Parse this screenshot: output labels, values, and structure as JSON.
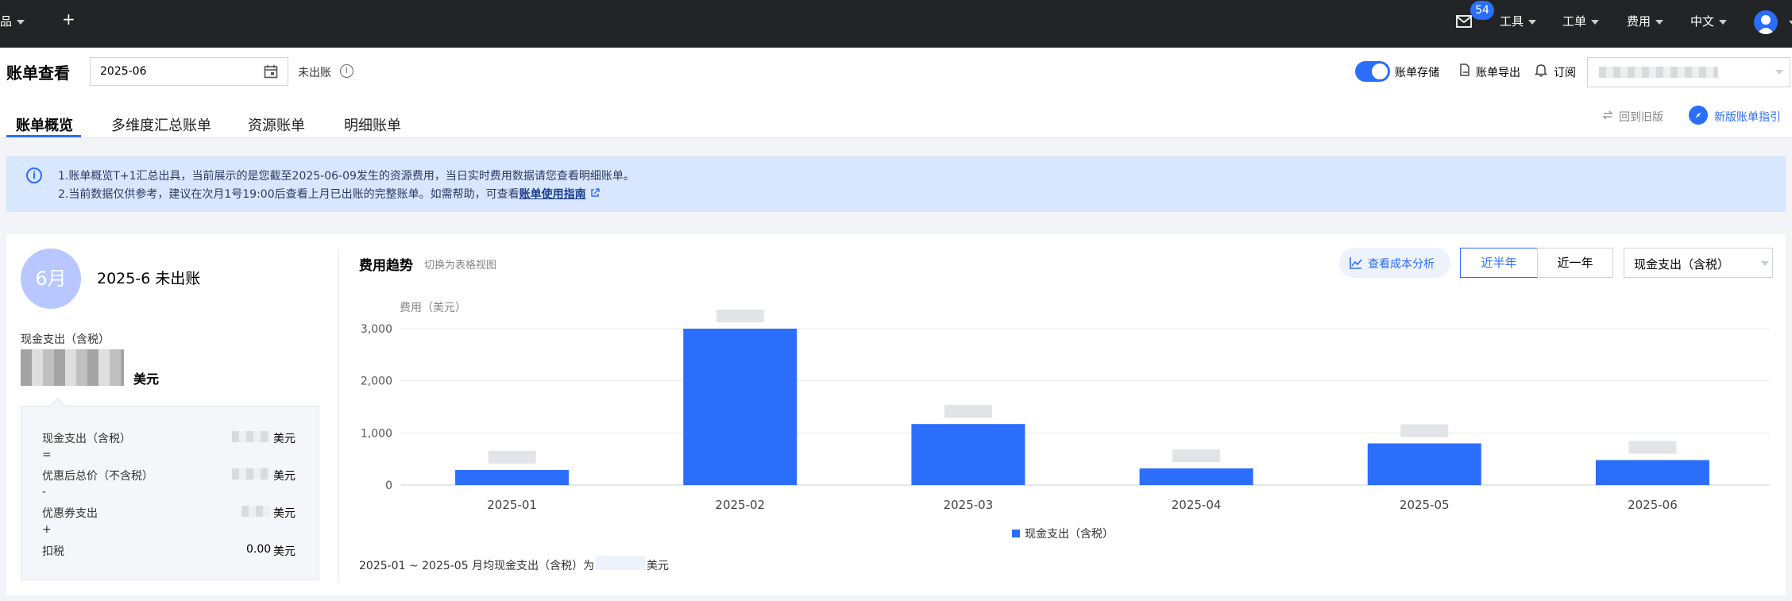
{
  "topbar": {
    "product_fragment": "品",
    "plus": "+",
    "mail_badge": "54",
    "menus": [
      "工具",
      "工单",
      "费用",
      "中文"
    ]
  },
  "header": {
    "title": "账单查看",
    "month_value": "2025-06",
    "status": "未出账",
    "storage_label": "账单存储",
    "export_label": "账单导出",
    "subscribe_label": "订阅",
    "back_old": "回到旧版",
    "new_guide": "新版账单指引"
  },
  "tabs": [
    "账单概览",
    "多维度汇总账单",
    "资源账单",
    "明细账单"
  ],
  "notice": {
    "line1": "1.账单概览T+1汇总出具，当前展示的是您截至2025-06-09发生的资源费用，当日实时费用数据请您查看明细账单。",
    "line2_prefix": "2.当前数据仅供参考，建议在次月1号19:00后查看上月已出账的完整账单。如需帮助，可查看",
    "line2_link": "账单使用指南"
  },
  "summary": {
    "month_circle": "6月",
    "heading": "2025-6 未出账",
    "cash_label": "现金支出（含税）",
    "unit": "美元",
    "rows": [
      {
        "label": "现金支出（含税）",
        "op": "=",
        "value": "",
        "unit": "美元"
      },
      {
        "label": "优惠后总价（不含税）",
        "op": "-",
        "value": "",
        "unit": "美元"
      },
      {
        "label": "优惠券支出",
        "op": "+",
        "value": "",
        "unit": "美元"
      },
      {
        "label": "扣税",
        "op": "",
        "value": "0.00",
        "unit": "美元"
      }
    ]
  },
  "trend": {
    "title": "费用趋势",
    "switch_view": "切换为表格视图",
    "cost_analysis": "查看成本分析",
    "range_options": [
      "近半年",
      "近一年"
    ],
    "selected_range": "近半年",
    "metric_select": "现金支出（含税）",
    "footer_prefix": "2025-01 ~ 2025-05 月均现金支出（含税）为",
    "footer_unit": "美元"
  },
  "chart_data": {
    "type": "bar",
    "categories": [
      "2025-01",
      "2025-02",
      "2025-03",
      "2025-04",
      "2025-05",
      "2025-06"
    ],
    "series": [
      {
        "name": "现金支出（含税）",
        "values": [
          290,
          3000,
          1170,
          320,
          800,
          480
        ]
      }
    ],
    "ylabel": "费用（美元）",
    "yticks": [
      0,
      1000,
      2000,
      3000
    ],
    "ytick_labels": [
      "0",
      "1,000",
      "2,000",
      "3,000"
    ],
    "ylim": [
      0,
      3000
    ],
    "grid": true,
    "legend_position": "bottom",
    "color": "#2b6efb"
  }
}
